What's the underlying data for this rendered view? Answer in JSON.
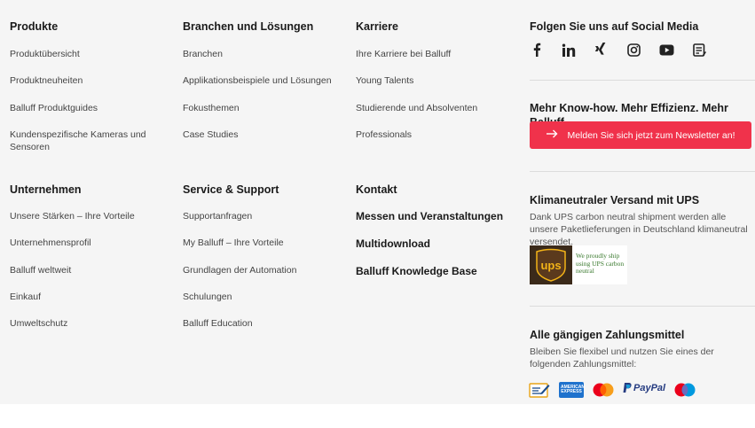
{
  "columns": [
    {
      "heading": "Produkte",
      "links": [
        "Produktübersicht",
        "Produktneuheiten",
        "Balluff Produktguides",
        "Kundenspezifische Kameras und Sensoren"
      ]
    },
    {
      "heading": "Branchen und Lösungen",
      "links": [
        "Branchen",
        "Applikationsbeispiele und Lösungen",
        "Fokusthemen",
        "Case Studies"
      ]
    },
    {
      "heading": "Karriere",
      "links": [
        "Ihre Karriere bei Balluff",
        "Young Talents",
        "Studierende und Absolventen",
        "Professionals"
      ]
    },
    {
      "heading": "Unternehmen",
      "links": [
        "Unsere Stärken – Ihre Vorteile",
        "Unternehmensprofil",
        "Balluff weltweit",
        "Einkauf",
        "Umweltschutz"
      ]
    },
    {
      "heading": "Service & Support",
      "links": [
        "Supportanfragen",
        "My Balluff – Ihre Vorteile",
        "Grundlagen der Automation",
        "Schulungen",
        "Balluff Education"
      ]
    },
    {
      "heading": "Kontakt",
      "links": [
        "Messen und Veranstaltungen",
        "Multidownload",
        "Balluff Knowledge Base"
      ]
    }
  ],
  "social": {
    "heading": "Folgen Sie uns auf Social Media",
    "icons": [
      "facebook-icon",
      "linkedin-icon",
      "xing-icon",
      "instagram-icon",
      "youtube-icon",
      "blog-icon"
    ]
  },
  "newsletter": {
    "heading": "Mehr Know-how. Mehr Effizienz. Mehr Balluff.",
    "button_label": "Melden Sie sich jetzt zum Newsletter an!",
    "accent": "#f0324b"
  },
  "ups": {
    "heading": "Klimaneutraler Versand mit UPS",
    "text": "Dank UPS carbon neutral shipment werden alle unsere Paketlieferungen in Deutschland klimaneutral versendet.",
    "logo_text": "ups",
    "badge_text": "We proudly ship using UPS carbon neutral"
  },
  "payment": {
    "heading": "Alle gängigen Zahlungsmittel",
    "text": "Bleiben Sie flexibel und nutzen Sie eines der folgenden Zahlungsmittel:",
    "methods": [
      "invoice-icon",
      "american-express-icon",
      "mastercard-icon",
      "paypal-icon",
      "maestro-icon"
    ],
    "amex_text": "AMERICAN EXPRESS",
    "paypal_text": "PayPal"
  }
}
